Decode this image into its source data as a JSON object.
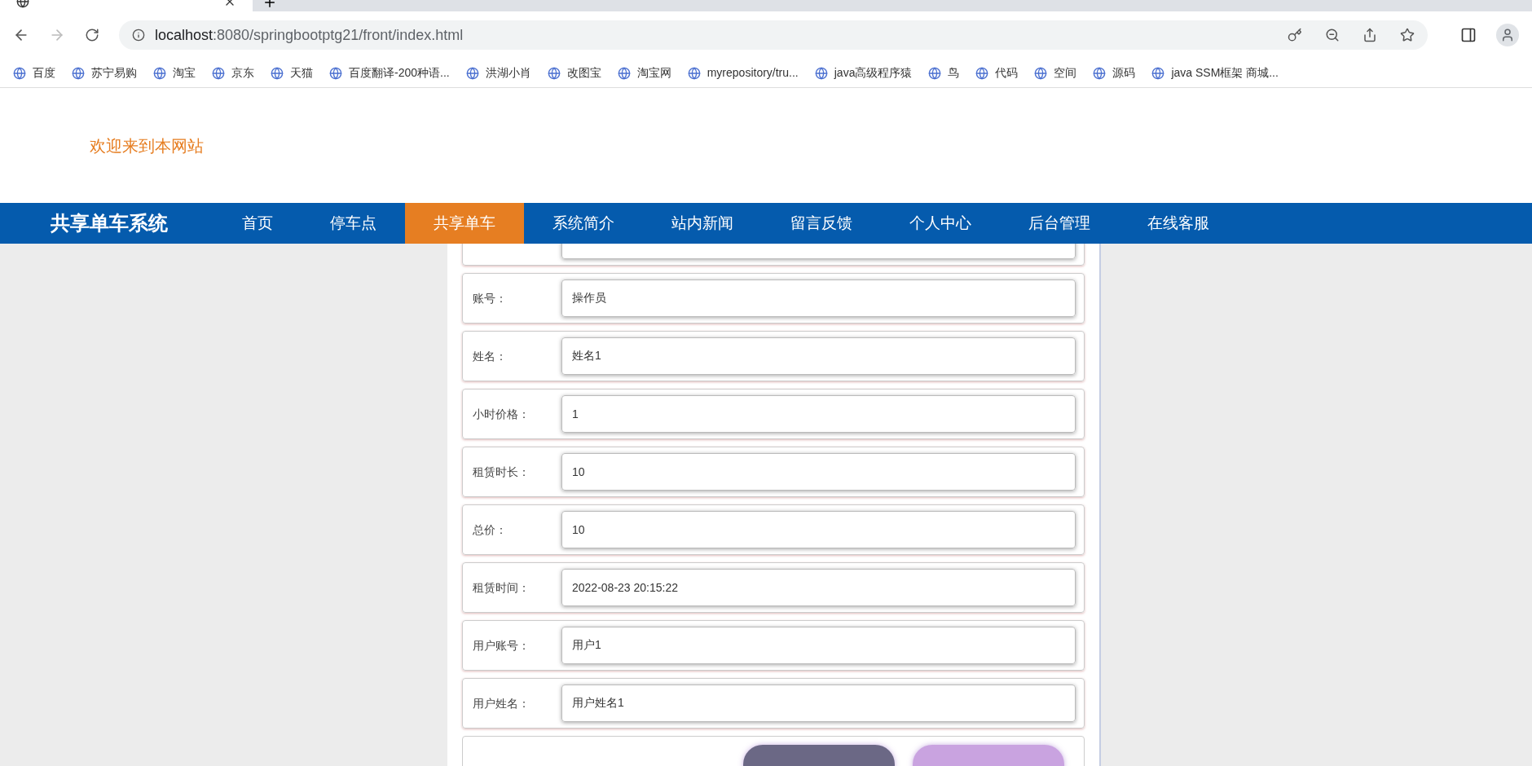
{
  "browser": {
    "url_host": "localhost",
    "url_rest": ":8080/springbootptg21/front/index.html",
    "bookmarks": [
      "百度",
      "苏宁易购",
      "淘宝",
      "京东",
      "天猫",
      "百度翻译-200种语...",
      "洪湖小肖",
      "改图宝",
      "淘宝网",
      "myrepository/tru...",
      "java高级程序猿",
      "鸟",
      "代码",
      "空间",
      "源码",
      "java SSM框架 商城..."
    ]
  },
  "welcome": "欢迎来到本网站",
  "nav": {
    "brand": "共享单车系统",
    "items": [
      {
        "label": "首页",
        "selected": false
      },
      {
        "label": "停车点",
        "selected": false
      },
      {
        "label": "共享单车",
        "selected": true
      },
      {
        "label": "系统简介",
        "selected": false
      },
      {
        "label": "站内新闻",
        "selected": false
      },
      {
        "label": "留言反馈",
        "selected": false
      },
      {
        "label": "个人中心",
        "selected": false
      },
      {
        "label": "后台管理",
        "selected": false
      },
      {
        "label": "在线客服",
        "selected": false
      }
    ]
  },
  "form": {
    "fields": [
      {
        "kind": "cut"
      },
      {
        "kind": "text",
        "label": "账号：",
        "value": "操作员"
      },
      {
        "kind": "text",
        "label": "姓名：",
        "value": "姓名1"
      },
      {
        "kind": "text",
        "label": "小时价格：",
        "value": "1"
      },
      {
        "kind": "text",
        "label": "租赁时长：",
        "value": "10"
      },
      {
        "kind": "text",
        "label": "总价：",
        "value": "10"
      },
      {
        "kind": "text",
        "label": "租赁时间：",
        "value": "2022-08-23 20:15:22"
      },
      {
        "kind": "text",
        "label": "用户账号：",
        "value": "用户1"
      },
      {
        "kind": "text",
        "label": "用户姓名：",
        "value": "用户姓名1"
      }
    ],
    "buttons": [
      {
        "kind": "submit"
      },
      {
        "kind": "reset"
      }
    ]
  }
}
